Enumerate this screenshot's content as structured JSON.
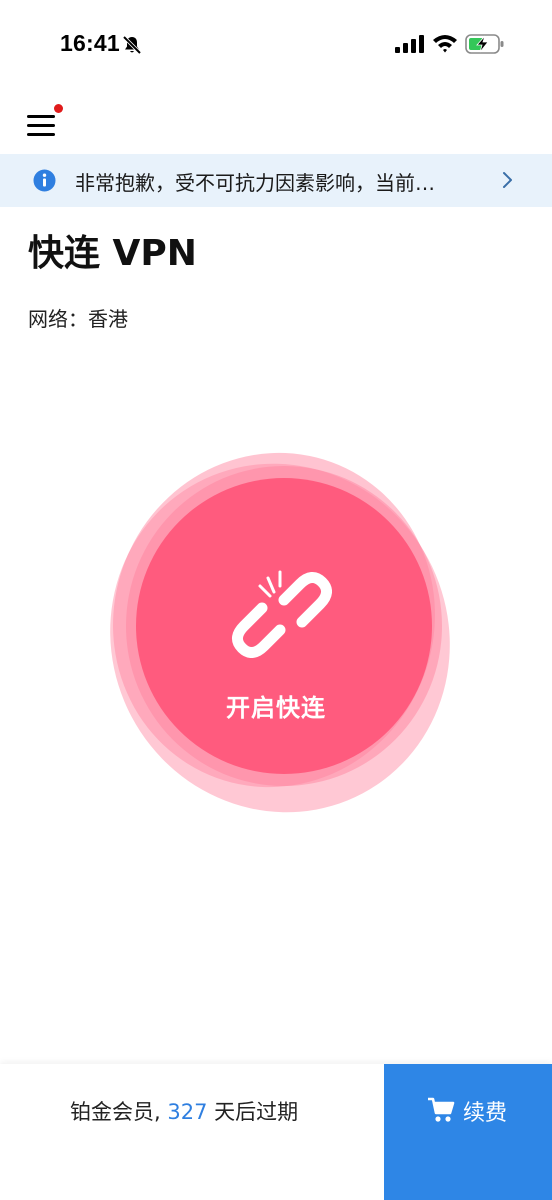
{
  "status_bar": {
    "time": "16:41",
    "bell_icon": "bell-slash-icon",
    "signal_icon": "cellular-signal-icon",
    "wifi_icon": "wifi-icon",
    "battery_icon": "battery-charging-icon"
  },
  "header": {
    "menu_icon": "hamburger-menu-icon",
    "has_notification": true
  },
  "notice": {
    "text": "非常抱歉，受不可抗力因素影响，当前…",
    "info_icon": "info-icon",
    "chevron_icon": "chevron-right-icon"
  },
  "main": {
    "title": "快连 VPN",
    "network_label": "网络：",
    "network_value": "香港",
    "connect_button": {
      "label": "开启快连",
      "icon": "broken-link-icon"
    }
  },
  "footer": {
    "membership_prefix": "铂金会员, ",
    "days": "327",
    "membership_suffix": " 天后过期",
    "renew_label": "续费",
    "cart_icon": "shopping-cart-icon"
  },
  "colors": {
    "accent_pink": "#ff5b7e",
    "accent_blue": "#2e86e6",
    "banner_bg": "#e8f2fb",
    "notification_red": "#e01b1b"
  }
}
